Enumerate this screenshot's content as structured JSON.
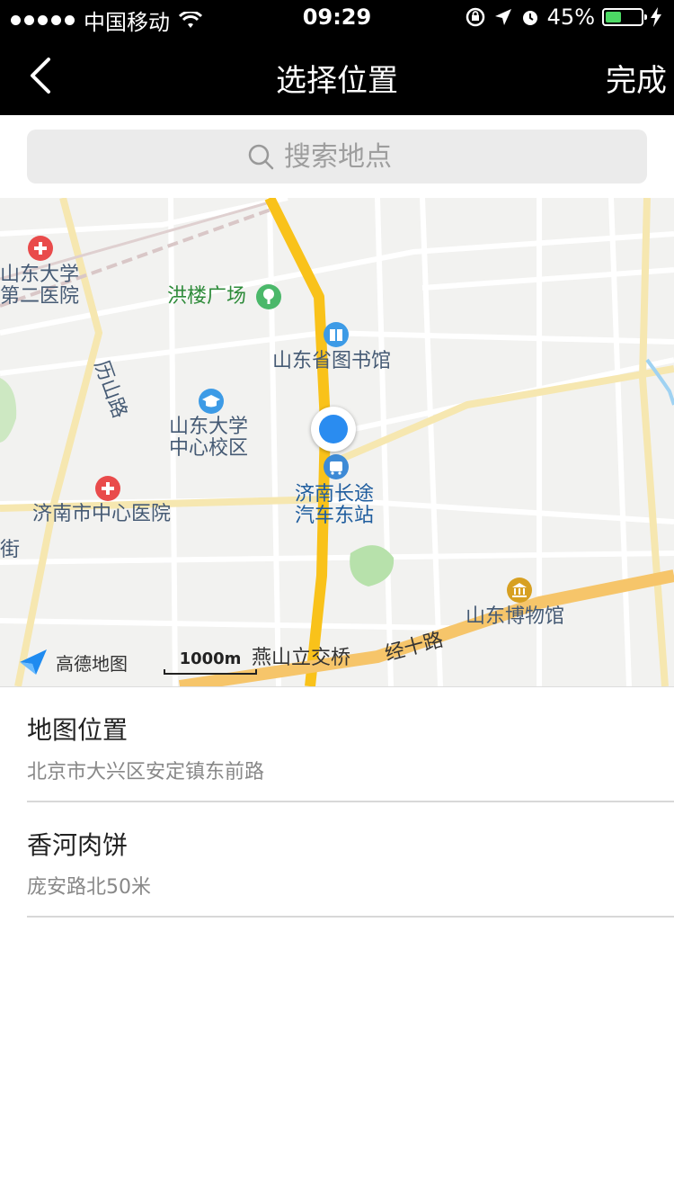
{
  "status_bar": {
    "carrier": "中国移动",
    "time": "09:29",
    "battery_text": "45%",
    "battery_level": 0.45,
    "battery_color": "#4cd964"
  },
  "nav": {
    "title": "选择位置",
    "done_label": "完成",
    "back_icon": "chevron-left-icon"
  },
  "search": {
    "placeholder": "搜索地点"
  },
  "map": {
    "provider": "高德地图",
    "scale": "1000m",
    "labels": {
      "sdu2_line1": "山东大学",
      "sdu2_line2": "第二医院",
      "honglou": "洪楼广场",
      "library": "山东省图书馆",
      "lishan": "历山路",
      "sdu_c1": "山东大学",
      "sdu_c2": "中心校区",
      "central_hospital": "济南市中心医院",
      "bus_line1": "济南长途",
      "bus_line2": "汽车东站",
      "street": "街",
      "museum": "山东博物馆",
      "yanshan": "燕山立交桥",
      "jingshi": "经十路"
    },
    "pin_color": "#2a8cf0",
    "road_color": "#f9c21a"
  },
  "results": [
    {
      "title": "地图位置",
      "subtitle": "北京市大兴区安定镇东前路"
    },
    {
      "title": "香河肉饼",
      "subtitle": "庞安路北50米"
    }
  ]
}
